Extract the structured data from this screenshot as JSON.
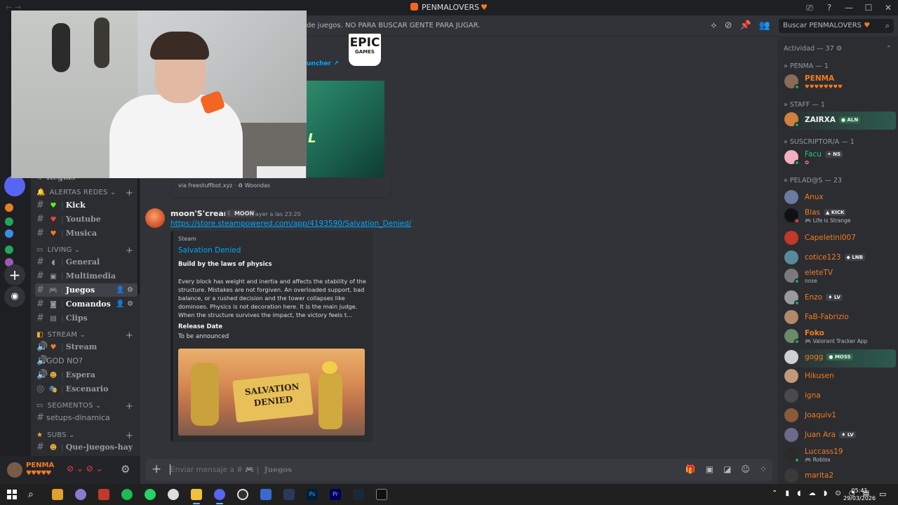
{
  "window": {
    "title": "PENMALOVERS",
    "title_heart": "♥",
    "controls": [
      "⎚",
      "?",
      "—",
      "☐",
      "✕"
    ]
  },
  "header": {
    "topic": "de juegos. NO PARA BUSCAR GENTE PARA JUGAR.",
    "search_placeholder": "Buscar PENMALOVERS",
    "search_heart": "♥"
  },
  "sidebar": {
    "partial_top": "Reglas",
    "categories": {
      "alertas": "ALERTAS REDES",
      "living": "LIVING",
      "stream": "STREAM",
      "segmentos": "SEGMENTOS",
      "subs": "SUBS"
    },
    "channels": {
      "kick": "Kick",
      "youtube": "Youtube",
      "musica": "Musica",
      "general": "General",
      "multimedia": "Multimedia",
      "juegos": "Juegos",
      "comandos": "Comandos",
      "clips": "Clips",
      "stream": "Stream",
      "god_no": "GOD NO?",
      "espera": "Espera",
      "escenario": "Escenario",
      "setups": "setups-dinamica",
      "que_juegos": "Que-juegos-hay"
    }
  },
  "user_panel": {
    "name": "PENMA",
    "status": "♥♥♥♥♥"
  },
  "messages": {
    "epic": {
      "logo_top": "EPIC",
      "logo_bottom": "GAMES",
      "link_tail": "uncher ↗",
      "footer": "via freestuffbot.xyz · ♻ Woondas"
    },
    "steam": {
      "author": "moon'S'creamer",
      "tag": "MOON",
      "time": "ayer a las 23:20",
      "link": "https://store.steampowered.com/app/4193590/Salvation_Denied/",
      "provider": "Steam",
      "title": "Salvation Denied",
      "desc_heading": "Build by the laws of physics",
      "description": "Every block has weight and inertia and affects the stability of the structure. Mistakes are not forgiven. An overloaded support, bad balance, or a rushed decision and the tower collapses like dominoes. Physics is not decoration here. It is the main judge. When the structure survives the impact, the victory feels t...",
      "field_name": "Release Date",
      "field_value": "To be announced",
      "image_text": "SALVATION DENIED"
    }
  },
  "input": {
    "placeholder": "Enviar mensaje a #",
    "channel": "Juegos"
  },
  "members": {
    "activity": "Actividad — 37",
    "groups": {
      "penma": "PENMA — 1",
      "staff": "STAFF — 1",
      "suscriptor": "SUSCRIPTOR/A — 1",
      "pelados": "PELAD@S — 23"
    },
    "list": [
      {
        "name": "PENMA",
        "sub": "♥♥♥♥♥♥♥♥",
        "color": "#f47b20"
      },
      {
        "name": "ZAIRXA",
        "tag": "ALN",
        "color": "#f2f3f5"
      },
      {
        "name": "Facu",
        "tag": "NS",
        "sub": "✿",
        "color": "#2dc770"
      },
      {
        "name": "Anux",
        "color": "#f47b20"
      },
      {
        "name": "Blas",
        "tag": "KICK",
        "sub": "Life is Strange",
        "color": "#f47b20"
      },
      {
        "name": "Capeletini007",
        "color": "#f47b20"
      },
      {
        "name": "cotice123",
        "tag": "LNB",
        "color": "#f47b20"
      },
      {
        "name": "eleteTV",
        "sub": "nose",
        "color": "#f47b20"
      },
      {
        "name": "Enzo",
        "tag": "LV",
        "color": "#f47b20"
      },
      {
        "name": "FaB-Fabrizio",
        "color": "#f47b20"
      },
      {
        "name": "Foko",
        "sub": "Valorant Tracker App",
        "color": "#f47b20"
      },
      {
        "name": "gogg",
        "tag": "MOSS",
        "color": "#f47b20"
      },
      {
        "name": "Hikusen",
        "color": "#f47b20"
      },
      {
        "name": "igna",
        "color": "#f47b20"
      },
      {
        "name": "Joaquiv1",
        "color": "#f47b20"
      },
      {
        "name": "Juan Ara",
        "tag": "LV",
        "color": "#f47b20"
      },
      {
        "name": "Luccass19",
        "sub": "Roblox",
        "color": "#f47b20"
      },
      {
        "name": "marita2",
        "color": "#f47b20"
      }
    ]
  },
  "taskbar": {
    "time": "05:41",
    "date": "29/03/2026"
  },
  "colors": {
    "accent": "#f47b20",
    "link": "#00a8fc",
    "online": "#23a55a",
    "dnd": "#f23f43"
  }
}
